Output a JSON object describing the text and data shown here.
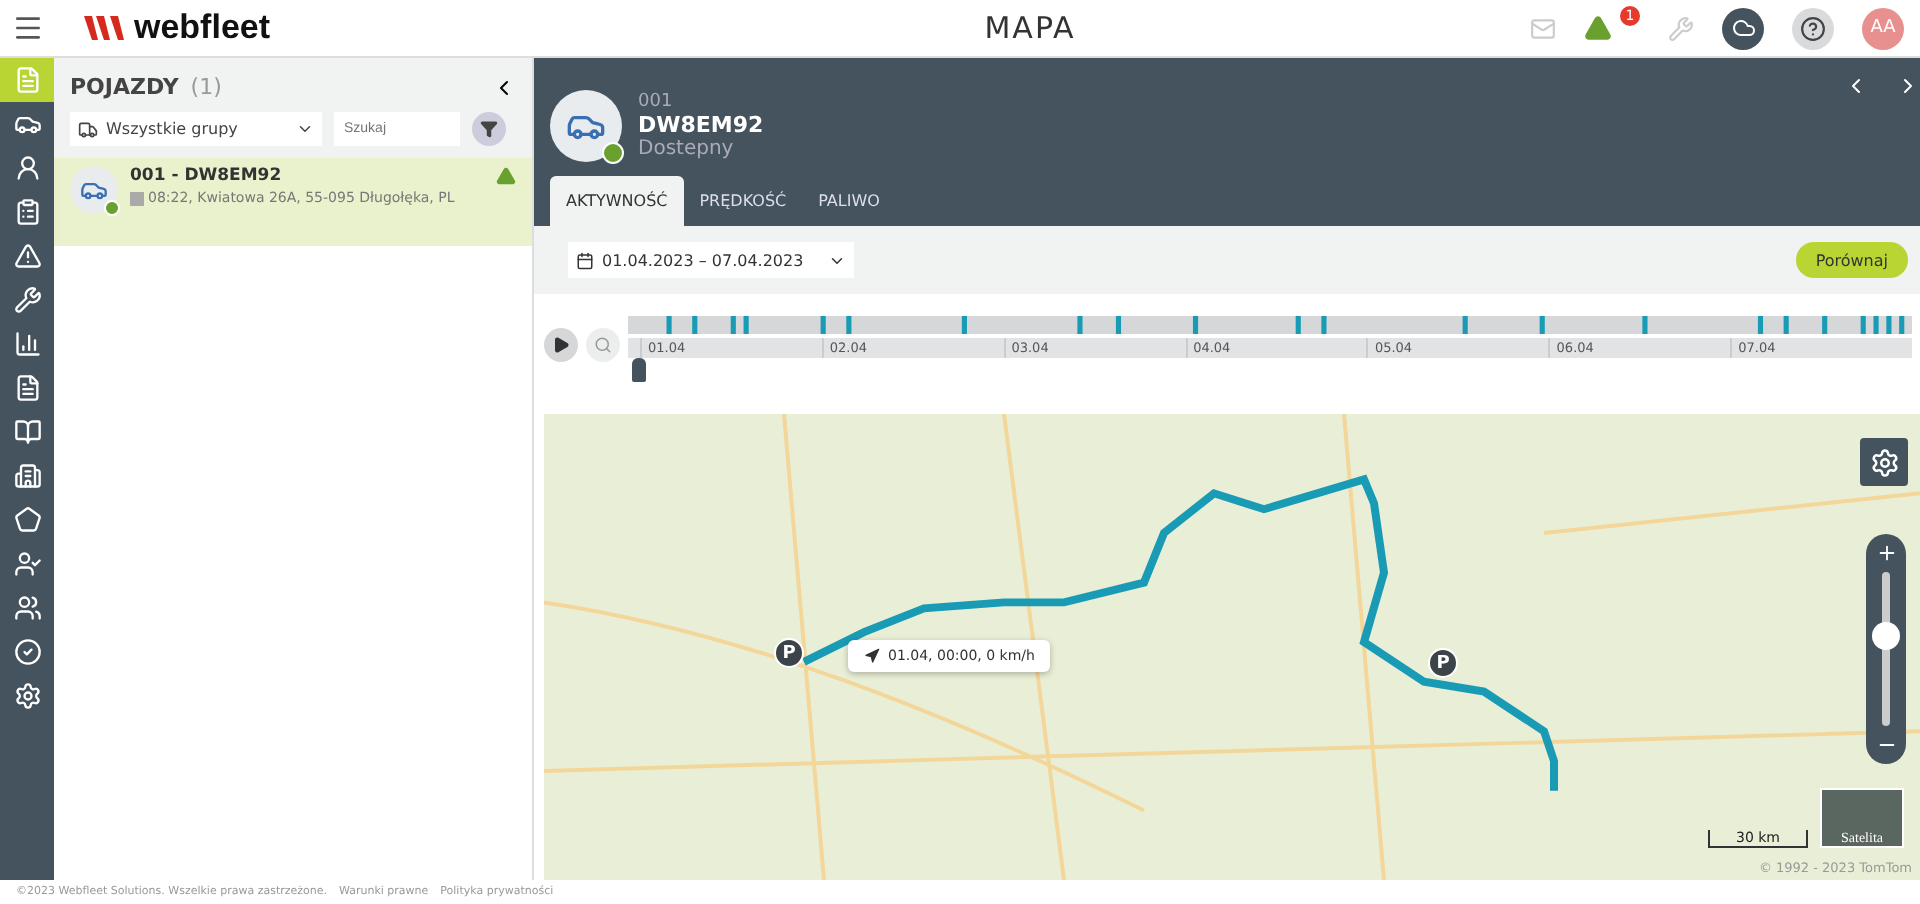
{
  "header": {
    "logo": "webfleet",
    "title": "MAPA",
    "alert_count": "1",
    "avatar": "AA"
  },
  "nav": [
    {
      "selected": true
    },
    {
      "selected": false
    },
    {
      "selected": false
    },
    {
      "selected": false
    },
    {
      "selected": false
    },
    {
      "selected": false
    },
    {
      "selected": false
    },
    {
      "selected": false
    },
    {
      "selected": false
    },
    {
      "selected": false
    },
    {
      "selected": false
    },
    {
      "selected": false
    },
    {
      "selected": false
    },
    {
      "selected": false
    },
    {
      "selected": false
    }
  ],
  "vehicles_panel": {
    "title": "POJAZDY",
    "count": "(1)",
    "group_select": "Wszystkie grupy",
    "search_placeholder": "Szukaj"
  },
  "vehicles": [
    {
      "name": "001 - DW8EM92",
      "time": "08:22,",
      "address": "Kwiatowa 26A, 55-095 Długołęka, PL",
      "selected": true,
      "warning": true,
      "online": true
    }
  ],
  "detail": {
    "number": "001",
    "plate": "DW8EM92",
    "status": "Dostepny",
    "online": true
  },
  "tabs": [
    {
      "label": "AKTYWNOŚĆ",
      "selected": true
    },
    {
      "label": "PRĘDKOŚĆ",
      "selected": false
    },
    {
      "label": "PALIWO",
      "selected": false
    }
  ],
  "date_range": "01.04.2023 – 07.04.2023",
  "compare_button": "Porównaj",
  "timeline": {
    "dates": [
      "01.04",
      "02.04",
      "03.04",
      "04.04",
      "05.04",
      "06.04",
      "07.04"
    ],
    "level": 0
  },
  "map": {
    "markers": [
      {
        "label": "P"
      },
      {
        "label": "P"
      }
    ],
    "tooltip": "01.04, 00:00, 0 km/h",
    "zoom": {
      "level": 0.58
    },
    "satellite_label": "Satelita",
    "scale": "30 km",
    "copyright": "© 1992 - 2023 TomTom"
  },
  "footer": [
    "©2023 Webfleet Solutions. Wszelkie prawa zastrzeżone.",
    "Warunki prawne",
    "Polityka prywatności"
  ]
}
